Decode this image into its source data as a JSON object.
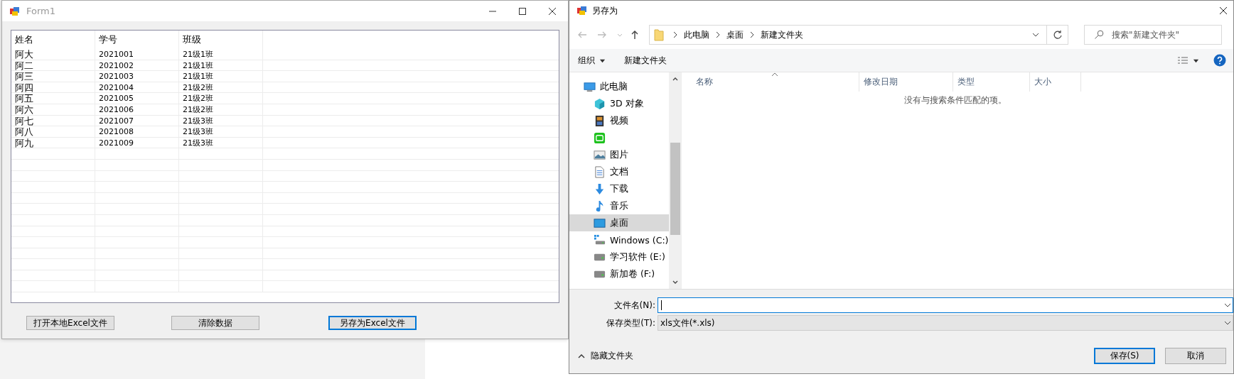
{
  "form": {
    "title": "Form1",
    "columns": [
      "姓名",
      "学号",
      "班级"
    ],
    "rows": [
      [
        "阿大",
        "2021001",
        "21级1班"
      ],
      [
        "阿二",
        "2021002",
        "21级1班"
      ],
      [
        "阿三",
        "2021003",
        "21级1班"
      ],
      [
        "阿四",
        "2021004",
        "21级2班"
      ],
      [
        "阿五",
        "2021005",
        "21级2班"
      ],
      [
        "阿六",
        "2021006",
        "21级2班"
      ],
      [
        "阿七",
        "2021007",
        "21级3班"
      ],
      [
        "阿八",
        "2021008",
        "21级3班"
      ],
      [
        "阿九",
        "2021009",
        "21级3班"
      ]
    ],
    "buttons": [
      {
        "label": "打开本地Excel文件",
        "focused": false
      },
      {
        "label": "清除数据",
        "focused": false
      },
      {
        "label": "另存为Excel文件",
        "focused": true
      }
    ]
  },
  "dialog": {
    "title": "另存为",
    "breadcrumb": [
      "此电脑",
      "桌面",
      "新建文件夹"
    ],
    "search": {
      "placeholder": "搜索\"新建文件夹\""
    },
    "toolbar": {
      "organize": "组织",
      "new_folder": "新建文件夹"
    },
    "sidebar": {
      "items": [
        {
          "kind": "pc",
          "label": "此电脑",
          "selected": false
        },
        {
          "kind": "cube",
          "label": "3D 对象",
          "selected": false
        },
        {
          "kind": "film",
          "label": "视频",
          "selected": false
        },
        {
          "kind": "app",
          "selected": false
        },
        {
          "kind": "image",
          "label": "图片",
          "selected": false
        },
        {
          "kind": "doc",
          "label": "文档",
          "selected": false
        },
        {
          "kind": "download",
          "label": "下载",
          "selected": false
        },
        {
          "kind": "music",
          "label": "音乐",
          "selected": false
        },
        {
          "kind": "desktop",
          "label": "桌面",
          "selected": true
        },
        {
          "kind": "windrive",
          "label": "Windows (C:)",
          "selected": false
        },
        {
          "kind": "drive",
          "label": "学习软件 (E:)",
          "selected": false
        },
        {
          "kind": "drive",
          "label": "新加卷 (F:)",
          "selected": false
        }
      ]
    },
    "file_columns": [
      "名称",
      "修改日期",
      "类型",
      "大小"
    ],
    "empty_message": "没有与搜索条件匹配的项。",
    "filename_label": "文件名(N):",
    "filetype_label": "保存类型(T):",
    "filetype_value": "xls文件(*.xls)",
    "hide_folders": "隐藏文件夹",
    "save_button": {
      "label": "保存(S)",
      "focused": true
    },
    "cancel_button": {
      "label": "取消",
      "focused": false
    }
  }
}
